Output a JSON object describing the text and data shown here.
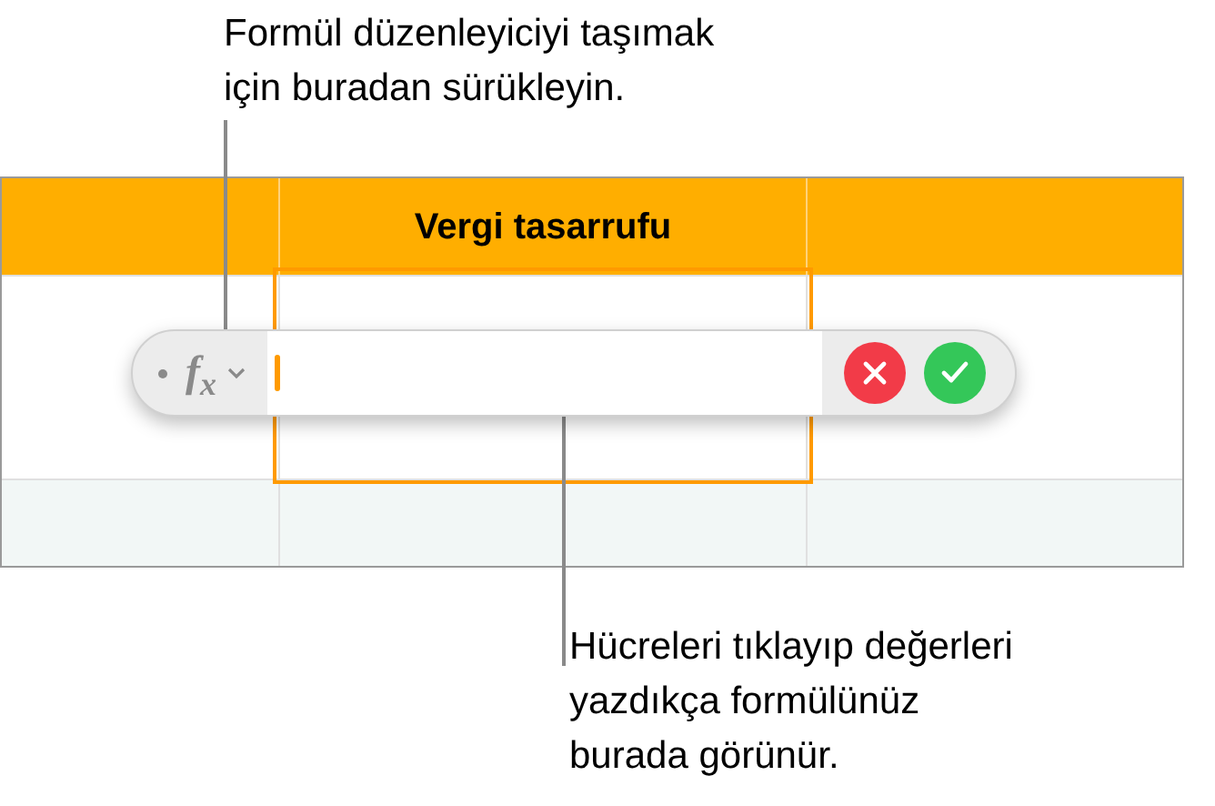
{
  "callouts": [
    {
      "text": "Formül düzenleyiciyi taşımak\niçin buradan sürükleyin."
    },
    {
      "text": "Hücreleri tıklayıp değerleri\nyazdıkça formülünüz\nburada görünür."
    }
  ],
  "table": {
    "header": {
      "column_2": "Vergi tasarrufu"
    }
  },
  "formula_editor": {
    "fx": "f$_{x}$"
  }
}
